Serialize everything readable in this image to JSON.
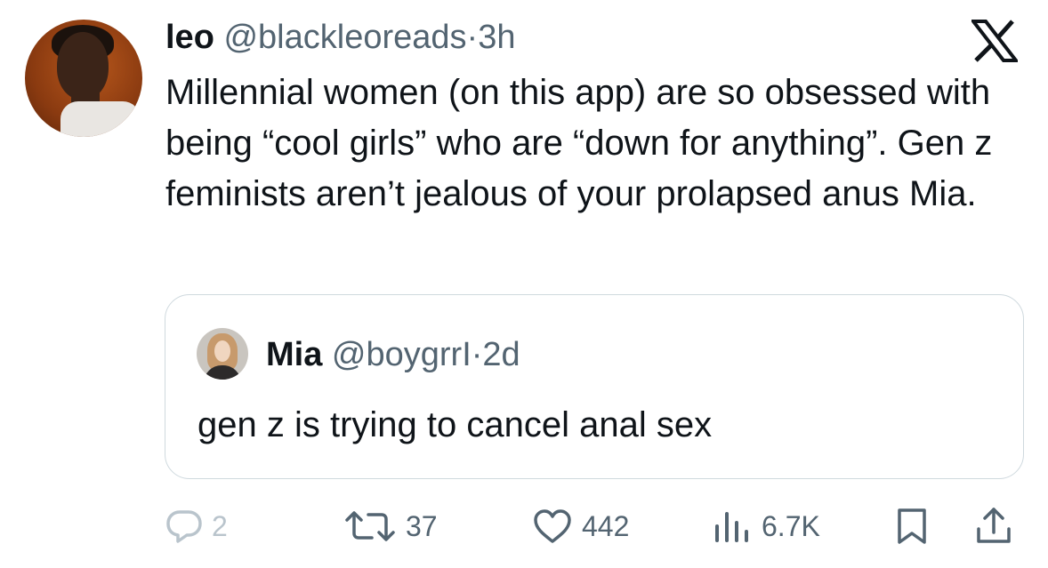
{
  "tweet": {
    "author_name": "leo",
    "author_handle": "@blackleoreads",
    "separator": "·",
    "time": "3h",
    "text": "Millennial women (on this app) are so obsessed with being “cool girls” who are “down for anything”. Gen z feminists aren’t jealous of your prolapsed anus Mia."
  },
  "quote": {
    "author_name": "Mia",
    "author_handle": "@boygrrI",
    "separator": "·",
    "time": "2d",
    "text": "gen z is trying to cancel anal sex"
  },
  "actions": {
    "replies": "2",
    "retweets": "37",
    "likes": "442",
    "views": "6.7K"
  },
  "icons": {
    "brand": "x-logo-icon",
    "reply": "reply-icon",
    "retweet": "retweet-icon",
    "like": "heart-icon",
    "views": "views-icon",
    "bookmark": "bookmark-icon",
    "share": "share-icon"
  },
  "colors": {
    "text": "#0f1419",
    "secondary": "#536471",
    "muted": "#b9c4cc",
    "border": "#cfd9de"
  }
}
